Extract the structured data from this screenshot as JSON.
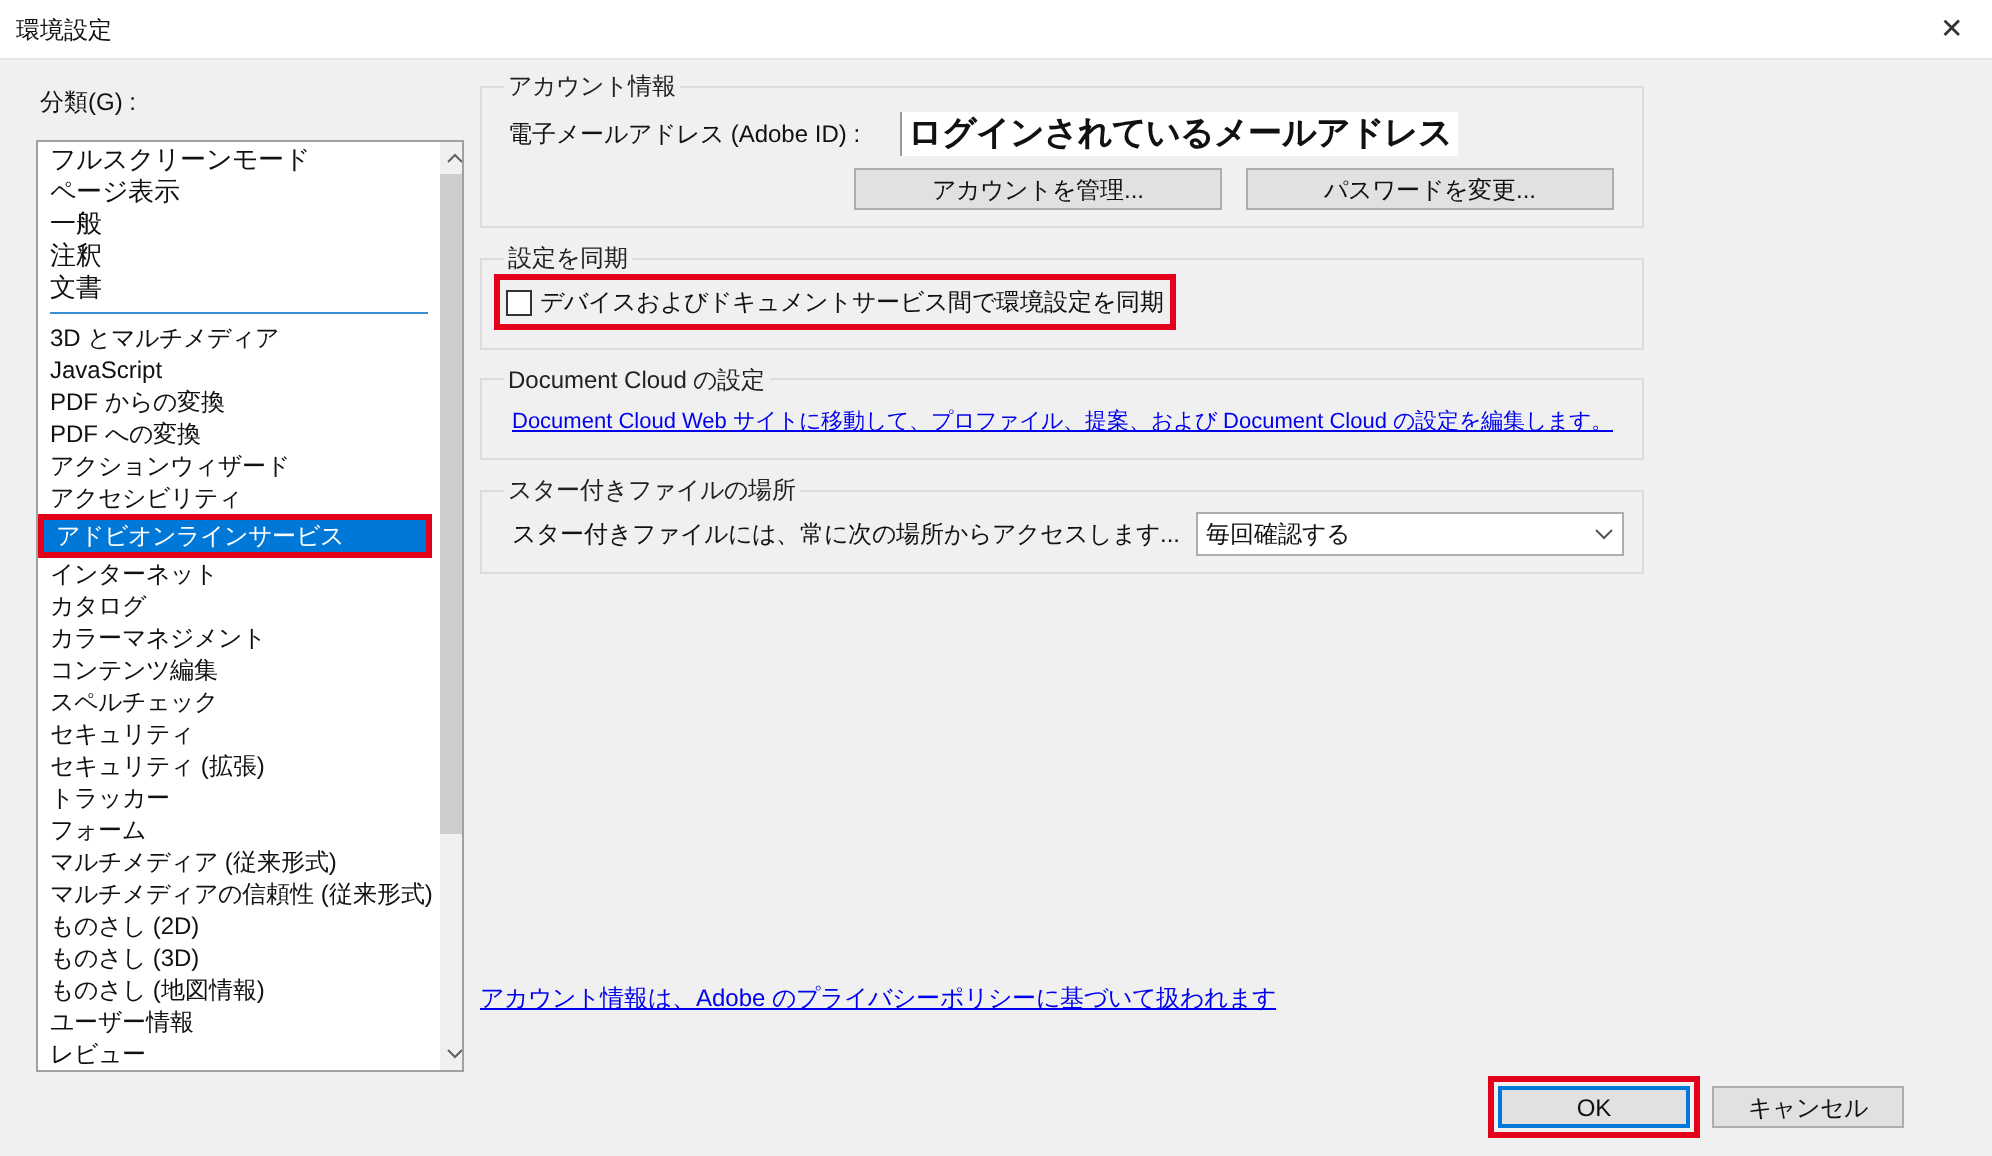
{
  "window": {
    "title": "環境設定",
    "close": "✕"
  },
  "sidebar": {
    "label": "分類(G) :",
    "groups": [
      {
        "items": [
          {
            "label": "フルスクリーンモード",
            "selected": false,
            "highlighted": false
          },
          {
            "label": "ページ表示",
            "selected": false,
            "highlighted": false
          },
          {
            "label": "一般",
            "selected": false,
            "highlighted": false
          },
          {
            "label": "注釈",
            "selected": false,
            "highlighted": false
          },
          {
            "label": "文書",
            "selected": false,
            "highlighted": false
          }
        ]
      },
      {
        "items": [
          {
            "label": "3D とマルチメディア",
            "selected": false,
            "highlighted": false
          },
          {
            "label": "JavaScript",
            "selected": false,
            "highlighted": false
          },
          {
            "label": "PDF からの変換",
            "selected": false,
            "highlighted": false
          },
          {
            "label": "PDF への変換",
            "selected": false,
            "highlighted": false
          },
          {
            "label": "アクションウィザード",
            "selected": false,
            "highlighted": false
          },
          {
            "label": "アクセシビリティ",
            "selected": false,
            "highlighted": false
          },
          {
            "label": "アドビオンラインサービス",
            "selected": true,
            "highlighted": true
          },
          {
            "label": "インターネット",
            "selected": false,
            "highlighted": false
          },
          {
            "label": "カタログ",
            "selected": false,
            "highlighted": false
          },
          {
            "label": "カラーマネジメント",
            "selected": false,
            "highlighted": false
          },
          {
            "label": "コンテンツ編集",
            "selected": false,
            "highlighted": false
          },
          {
            "label": "スペルチェック",
            "selected": false,
            "highlighted": false
          },
          {
            "label": "セキュリティ",
            "selected": false,
            "highlighted": false
          },
          {
            "label": "セキュリティ (拡張)",
            "selected": false,
            "highlighted": false
          },
          {
            "label": "トラッカー",
            "selected": false,
            "highlighted": false
          },
          {
            "label": "フォーム",
            "selected": false,
            "highlighted": false
          },
          {
            "label": "マルチメディア (従来形式)",
            "selected": false,
            "highlighted": false
          },
          {
            "label": "マルチメディアの信頼性 (従来形式)",
            "selected": false,
            "highlighted": false
          },
          {
            "label": "ものさし (2D)",
            "selected": false,
            "highlighted": false
          },
          {
            "label": "ものさし (3D)",
            "selected": false,
            "highlighted": false
          },
          {
            "label": "ものさし (地図情報)",
            "selected": false,
            "highlighted": false
          },
          {
            "label": "ユーザー情報",
            "selected": false,
            "highlighted": false
          },
          {
            "label": "レビュー",
            "selected": false,
            "highlighted": false
          }
        ]
      }
    ]
  },
  "account": {
    "title": "アカウント情報",
    "email_label": "電子メールアドレス (Adobe ID) :",
    "email_value": "ログインされているメールアドレス",
    "buttons": [
      "アカウントを管理...",
      "パスワードを変更..."
    ]
  },
  "sync": {
    "title": "設定を同期",
    "checkbox": {
      "label": "デバイスおよびドキュメントサービス間で環境設定を同期",
      "checked": false,
      "highlighted": true
    }
  },
  "document_cloud": {
    "title": "Document Cloud の設定",
    "link": "Document Cloud Web サイトに移動して、プロファイル、提案、および Document Cloud の設定を編集します。"
  },
  "starred": {
    "title": "スター付きファイルの場所",
    "label": "スター付きファイルには、常に次の場所からアクセスします...",
    "value": "毎回確認する"
  },
  "privacy_link": "アカウント情報は、Adobe のプライバシーポリシーに基づいて扱われます",
  "footer": [
    {
      "label": "OK",
      "kind": "default",
      "highlighted": true
    },
    {
      "label": "キャンセル",
      "kind": "normal",
      "highlighted": false
    }
  ]
}
